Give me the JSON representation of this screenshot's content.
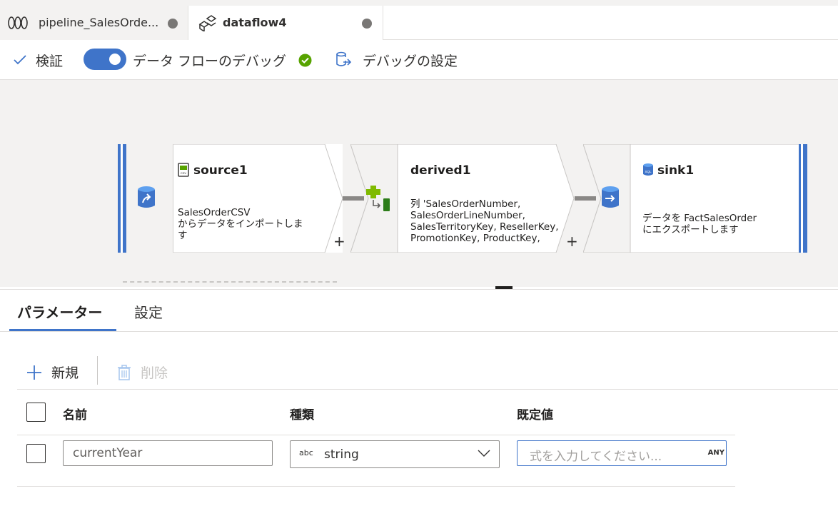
{
  "tabs": [
    {
      "label": "pipeline_SalesOrde...",
      "icon": "pipeline-icon"
    },
    {
      "label": "dataflow4",
      "icon": "dataflow-icon"
    }
  ],
  "toolbar": {
    "validate_label": "検証",
    "debug_label": "データ フローのデバッグ",
    "debug_settings_label": "デバッグの設定"
  },
  "nodes": {
    "source": {
      "title": "source1",
      "desc_line1": "SalesOrderCSV",
      "desc_line2": "からデータをインポートしま",
      "desc_line3": "す"
    },
    "derived": {
      "title": "derived1",
      "desc_line1": "列 'SalesOrderNumber,",
      "desc_line2": "SalesOrderLineNumber,",
      "desc_line3": "SalesTerritoryKey, ResellerKey,",
      "desc_line4": "PromotionKey, ProductKey,"
    },
    "sink": {
      "title": "sink1",
      "desc_line1": "データを FactSalesOrder",
      "desc_line2": "にエクスポートします"
    }
  },
  "plus_symbol": "+",
  "panel": {
    "tabs": [
      "パラメーター",
      "設定"
    ],
    "new_label": "新規",
    "delete_label": "削除",
    "columns": [
      "名前",
      "種類",
      "既定値"
    ],
    "row": {
      "name": "currentYear",
      "type_prefix": "abc",
      "type": "string",
      "default_placeholder": "式を入力してください...",
      "default_badge": "ANY"
    }
  },
  "colors": {
    "accent": "#3f74c9",
    "check_green": "#57a300"
  }
}
